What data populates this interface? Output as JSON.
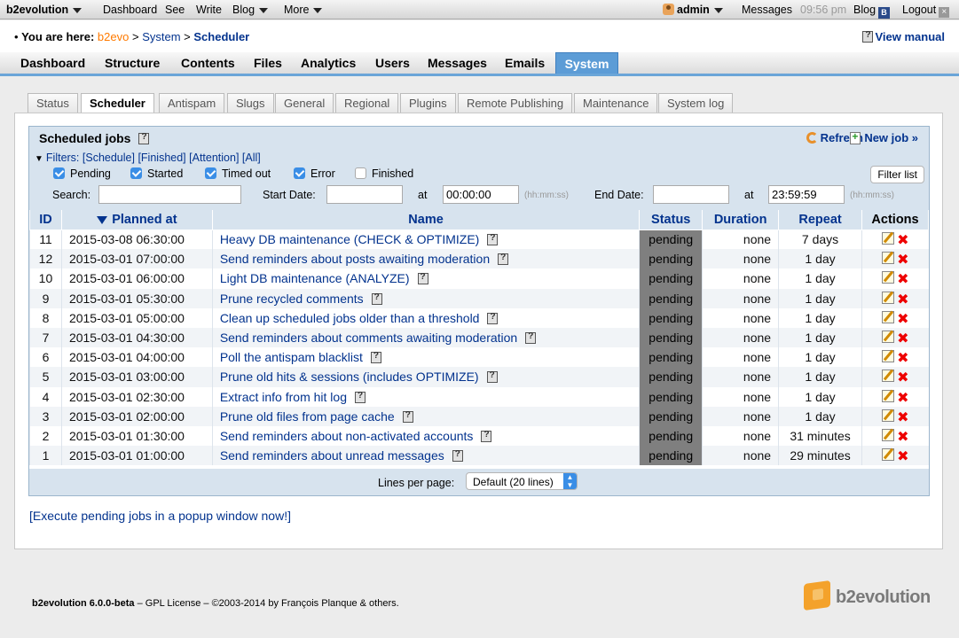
{
  "topbar": {
    "app": "b2evolution",
    "menu": [
      "Dashboard",
      "See",
      "Write",
      "Blog",
      "More"
    ],
    "user": "admin",
    "messages": "Messages",
    "time": "09:56 pm",
    "blog": "Blog",
    "blog_icon": "B",
    "logout": "Logout"
  },
  "crumbs": {
    "prefix": "You are here:",
    "items": [
      "b2evo",
      "System",
      "Scheduler"
    ],
    "sep": ">",
    "manual": "View manual"
  },
  "mainnav": [
    "Dashboard",
    "Structure",
    "Contents",
    "Files",
    "Analytics",
    "Users",
    "Messages",
    "Emails",
    "System"
  ],
  "subtabs": [
    "Status",
    "Scheduler",
    "Antispam",
    "Slugs",
    "General",
    "Regional",
    "Plugins",
    "Remote Publishing",
    "Maintenance",
    "System log"
  ],
  "box": {
    "title": "Scheduled jobs",
    "refresh": "Refresh",
    "new_job": "New job »",
    "filters_label": "Filters:",
    "filter_links": [
      "[Schedule]",
      "[Finished]",
      "[Attention]",
      "[All]"
    ],
    "checkboxes": [
      {
        "label": "Pending",
        "checked": true
      },
      {
        "label": "Started",
        "checked": true
      },
      {
        "label": "Timed out",
        "checked": true
      },
      {
        "label": "Error",
        "checked": true
      },
      {
        "label": "Finished",
        "checked": false
      }
    ],
    "search_label": "Search:",
    "search_value": "",
    "start_date_label": "Start Date:",
    "start_date_value": "",
    "at_label": "at",
    "start_time": "00:00:00",
    "time_hint": "(hh:mm:ss)",
    "end_date_label": "End Date:",
    "end_date_value": "",
    "end_time": "23:59:59",
    "filter_button": "Filter list"
  },
  "table": {
    "headers": [
      "ID",
      "Planned at",
      "Name",
      "Status",
      "Duration",
      "Repeat",
      "Actions"
    ],
    "rows": [
      {
        "id": "11",
        "planned": "2015-03-08 06:30:00",
        "name": "Heavy DB maintenance (CHECK & OPTIMIZE)",
        "status": "pending",
        "duration": "none",
        "repeat": "7 days"
      },
      {
        "id": "12",
        "planned": "2015-03-01 07:00:00",
        "name": "Send reminders about posts awaiting moderation",
        "status": "pending",
        "duration": "none",
        "repeat": "1 day"
      },
      {
        "id": "10",
        "planned": "2015-03-01 06:00:00",
        "name": "Light DB maintenance (ANALYZE)",
        "status": "pending",
        "duration": "none",
        "repeat": "1 day"
      },
      {
        "id": "9",
        "planned": "2015-03-01 05:30:00",
        "name": "Prune recycled comments",
        "status": "pending",
        "duration": "none",
        "repeat": "1 day"
      },
      {
        "id": "8",
        "planned": "2015-03-01 05:00:00",
        "name": "Clean up scheduled jobs older than a threshold",
        "status": "pending",
        "duration": "none",
        "repeat": "1 day"
      },
      {
        "id": "7",
        "planned": "2015-03-01 04:30:00",
        "name": "Send reminders about comments awaiting moderation",
        "status": "pending",
        "duration": "none",
        "repeat": "1 day"
      },
      {
        "id": "6",
        "planned": "2015-03-01 04:00:00",
        "name": "Poll the antispam blacklist",
        "status": "pending",
        "duration": "none",
        "repeat": "1 day"
      },
      {
        "id": "5",
        "planned": "2015-03-01 03:00:00",
        "name": "Prune old hits & sessions (includes OPTIMIZE)",
        "status": "pending",
        "duration": "none",
        "repeat": "1 day"
      },
      {
        "id": "4",
        "planned": "2015-03-01 02:30:00",
        "name": "Extract info from hit log",
        "status": "pending",
        "duration": "none",
        "repeat": "1 day"
      },
      {
        "id": "3",
        "planned": "2015-03-01 02:00:00",
        "name": "Prune old files from page cache",
        "status": "pending",
        "duration": "none",
        "repeat": "1 day"
      },
      {
        "id": "2",
        "planned": "2015-03-01 01:30:00",
        "name": "Send reminders about non-activated accounts",
        "status": "pending",
        "duration": "none",
        "repeat": "31 minutes"
      },
      {
        "id": "1",
        "planned": "2015-03-01 01:00:00",
        "name": "Send reminders about unread messages",
        "status": "pending",
        "duration": "none",
        "repeat": "29 minutes"
      }
    ]
  },
  "pager": {
    "label": "Lines per page:",
    "selected": "Default (20 lines)"
  },
  "exec_link": "[Execute pending jobs in a popup window now!]",
  "footer": {
    "product": "b2evolution 6.0.0-beta",
    "rest": " – GPL License – ©2003-2014 by François Planque & others."
  },
  "logo_text": "b2evolution"
}
